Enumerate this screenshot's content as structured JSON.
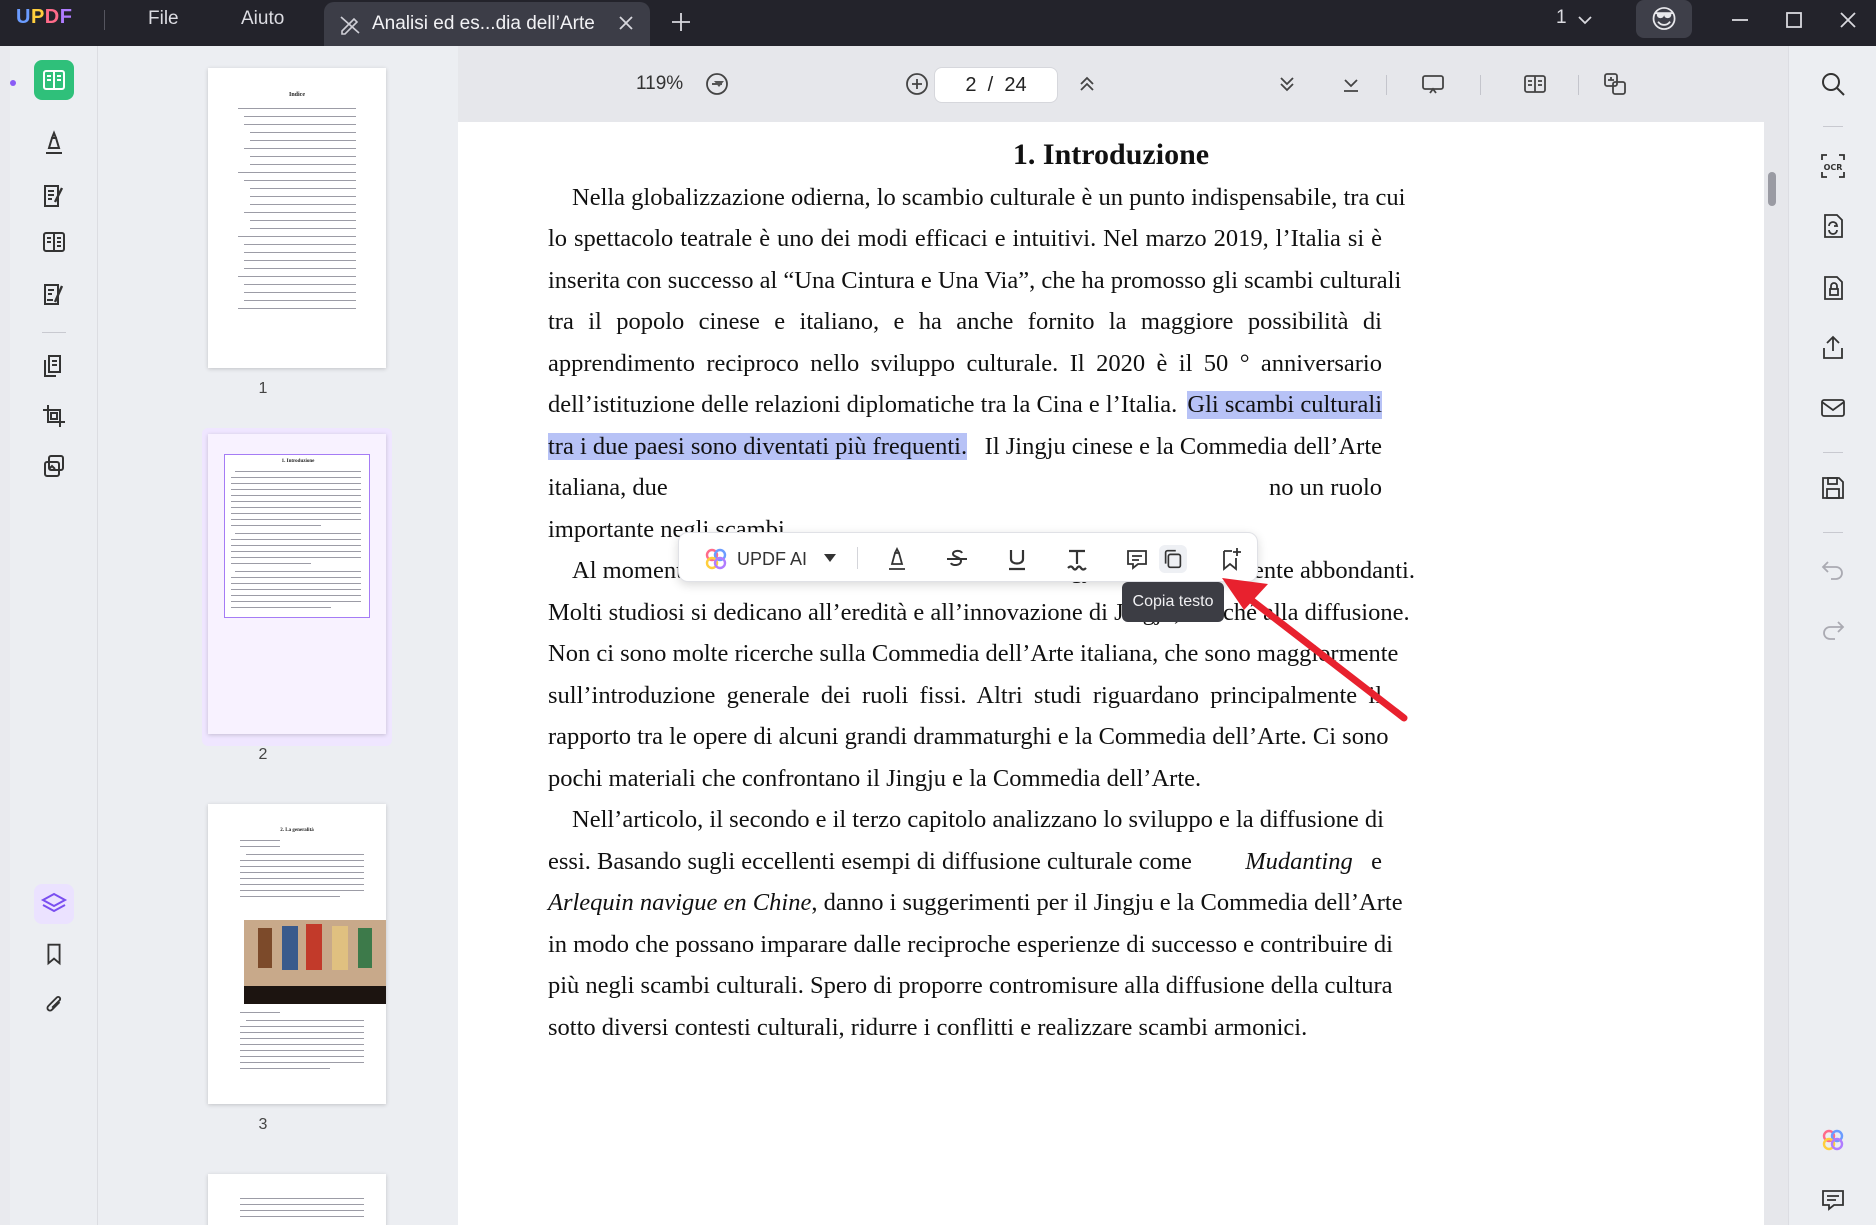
{
  "titlebar": {
    "logo": {
      "u": "U",
      "p": "P",
      "d": "D",
      "f": "F"
    },
    "menu": {
      "file": "File",
      "help": "Aiuto"
    },
    "tab_title": "Analisi ed es...dia dell’Arte",
    "page_count": "1"
  },
  "toolbar": {
    "zoom": "119%",
    "page_current": "2",
    "page_total": "24",
    "page_separator": "/"
  },
  "thumbnails": [
    {
      "number": "1",
      "heading": "Indice"
    },
    {
      "number": "2",
      "heading": "1. Introduzione"
    },
    {
      "number": "3",
      "heading": "2. La generalità"
    }
  ],
  "document": {
    "title": "1. Introduzione",
    "lines": {
      "l1": "Nella globalizzazione odierna, lo scambio culturale è un punto indispensabile, tra cui",
      "l2": "lo spettacolo teatrale è uno dei modi efficaci e intuitivi. Nel marzo 2019, l’Italia si è",
      "l3": "inserita con successo al “Una Cintura e Una Via”, che ha promosso gli scambi culturali",
      "l4": "tra il popolo cinese e italiano, e ha anche fornito la maggiore possibilità di",
      "l5": "apprendimento reciproco nello sviluppo culturale. Il 2020 è il 50 ° anniversario",
      "l6a": "dell’istituzione delle relazioni diplomatiche tra la Cina e l’Italia.",
      "l6b": "Gli scambi culturali",
      "l7a": "tra i due paesi sono diventati più frequenti.",
      "l7b": "Il Jingju cinese e la Commedia dell’Arte",
      "l8a": "italiana, due",
      "l8b": "no un ruolo",
      "l9": "importante negli scambi.",
      "l10": "Al momento, i materiali di ricerca nazionali sul Jingju sono relativamente abbondanti.",
      "l11": "Molti studiosi si dedicano all’eredità e all’innovazione di Jingju, nonché alla diffusione.",
      "l12": "Non ci sono molte ricerche sulla Commedia dell’Arte italiana, che sono maggiormente",
      "l13": "sull’introduzione generale dei ruoli fissi. Altri studi riguardano principalmente il",
      "l14": "rapporto tra le opere di alcuni grandi drammaturghi e la Commedia dell’Arte. Ci sono",
      "l15": "pochi materiali che confrontano il Jingju e la Commedia dell’Arte.",
      "l16": "Nell’articolo, il secondo e il terzo capitolo analizzano lo sviluppo e la diffusione di",
      "l17a": "essi. Basando sugli eccellenti esempi di diffusione culturale come",
      "l17b": "Mudanting",
      "l17c": "e",
      "l18a": "Arlequin navigue en Chine",
      "l18b": ", danno i suggerimenti per il Jingju e la Commedia dell’Arte",
      "l19": "in modo che possano imparare dalle reciproche esperienze di successo e contribuire di",
      "l20": "più negli scambi culturali. Spero di proporre contromisure alla diffusione della cultura",
      "l21": "sotto diversi contesti culturali, ridurre i conflitti e realizzare scambi armonici."
    }
  },
  "selection_toolbar": {
    "ai_label": "UPDF AI",
    "tooltip": "Copia testo"
  },
  "colors": {
    "accent_green": "#2fc07a",
    "highlight": "#b7c2f6",
    "arrow_red": "#e8212e",
    "titlebar": "#23232b"
  }
}
